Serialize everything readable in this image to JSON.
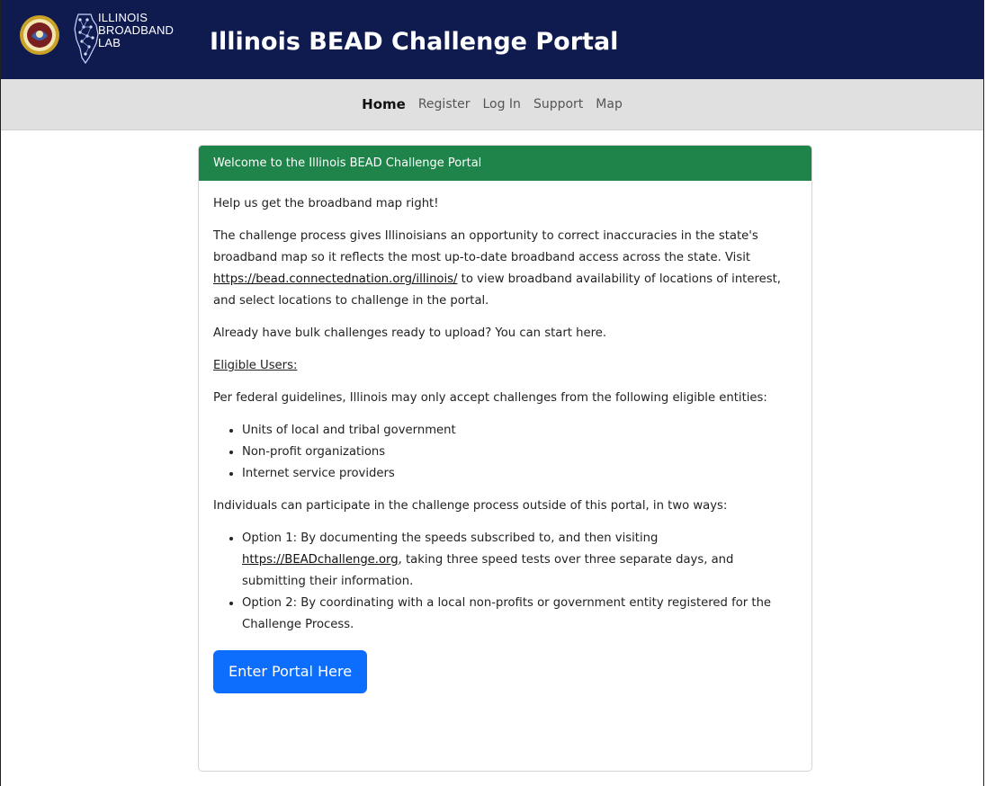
{
  "header": {
    "lab_name_lines": [
      "ILLINOIS",
      "BROADBAND",
      "LAB"
    ],
    "title": "Illinois BEAD Challenge Portal",
    "seal_icon": "state-seal-icon",
    "lab_icon": "illinois-map-network-icon",
    "background_color": "#0f1b4f"
  },
  "nav": {
    "items": [
      {
        "label": "Home",
        "active": true
      },
      {
        "label": "Register",
        "active": false
      },
      {
        "label": "Log In",
        "active": false
      },
      {
        "label": "Support",
        "active": false
      },
      {
        "label": "Map",
        "active": false
      }
    ]
  },
  "card": {
    "header": "Welcome to the Illinois BEAD Challenge Portal",
    "header_color": "#1e8449",
    "intro": "Help us get the broadband map right!",
    "paragraph1_before": "The challenge process gives Illinoisians an opportunity to correct inaccuracies in the state's broadband map so it reflects the most up-to-date broadband access across the state. Visit ",
    "paragraph1_link": "https://bead.connectednation.org/illinois/",
    "paragraph1_after": " to view broadband availability of locations of interest, and select locations to challenge in the portal.",
    "bulk": "Already have bulk challenges ready to upload? You can start here.",
    "eligible_heading": "Eligible Users:",
    "federal": "Per federal guidelines, Illinois may only accept challenges from the following eligible entities:",
    "entities": [
      "Units of local and tribal government",
      "Non-profit organizations",
      "Internet service providers"
    ],
    "individuals": "Individuals can participate in the challenge process outside of this portal, in two ways:",
    "option1_before": "Option 1: By documenting the speeds subscribed to, and then visiting ",
    "option1_link": "https://BEADchallenge.org",
    "option1_after": ", taking three speed tests over three separate days, and submitting their information.",
    "option2": "Option 2: By coordinating with a local non-profits or government entity registered for the Challenge Process.",
    "button_label": "Enter Portal Here",
    "button_color": "#0d6efd"
  }
}
